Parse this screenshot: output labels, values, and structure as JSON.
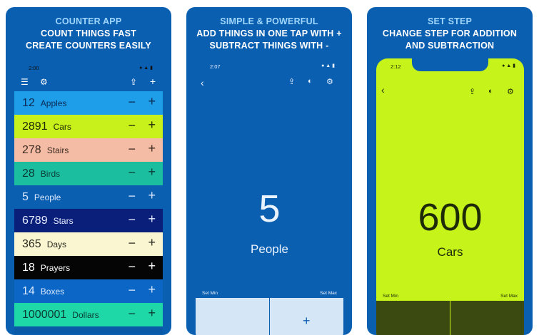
{
  "panel1": {
    "caption": [
      "COUNTER APP",
      "COUNT THINGS FAST",
      "CREATE COUNTERS EASILY"
    ],
    "time": "2:00",
    "status_icons": "● ▲ ▮",
    "menu_icon": "☰",
    "settings_icon": "⚙",
    "share_icon": "⇪",
    "add_icon": "+",
    "counters": [
      {
        "count": "12",
        "name": "Apples",
        "bg": "#1e9de8",
        "fg": "#0b2b55"
      },
      {
        "count": "2891",
        "name": "Cars",
        "bg": "#c8f01a",
        "fg": "#1d2a0a"
      },
      {
        "count": "278",
        "name": "Stairs",
        "bg": "#f4bca5",
        "fg": "#3a2a20"
      },
      {
        "count": "28",
        "name": "Birds",
        "bg": "#1bbfa0",
        "fg": "#0c3b36"
      },
      {
        "count": "5",
        "name": "People",
        "bg": "#0b5fb0",
        "fg": "#d9e8ff"
      },
      {
        "count": "6789",
        "name": "Stars",
        "bg": "#0a1f7a",
        "fg": "#e8ecff"
      },
      {
        "count": "365",
        "name": "Days",
        "bg": "#faf6d2",
        "fg": "#2c2c20"
      },
      {
        "count": "18",
        "name": "Prayers",
        "bg": "#050505",
        "fg": "#ffffff"
      },
      {
        "count": "14",
        "name": "Boxes",
        "bg": "#0b66c6",
        "fg": "#d9e8ff"
      },
      {
        "count": "1000001",
        "name": "Dollars",
        "bg": "#1fd8a8",
        "fg": "#0b3b30"
      }
    ],
    "minus": "−",
    "plus": "+"
  },
  "panel2": {
    "caption": [
      "SIMPLE & POWERFUL",
      "ADD THINGS IN ONE TAP WITH +",
      "SUBTRACT THINGS WITH -"
    ],
    "time": "2:07",
    "status_icons": "● ▲ ▮",
    "back_icon": "‹",
    "share_icon": "⇪",
    "palette_icon": "◐",
    "settings_icon": "⚙",
    "count": "5",
    "name": "People",
    "set_min": "Set Min",
    "set_max": "Set Max",
    "bg": "#0b5fb0",
    "text": "#e9f2ff",
    "plus": "+"
  },
  "panel3": {
    "caption": [
      "SET STEP",
      "CHANGE STEP FOR ADDITION",
      "AND SUBTRACTION"
    ],
    "time": "2:12",
    "status_icons": "● ▲ ▮",
    "back_icon": "‹",
    "share_icon": "⇪",
    "palette_icon": "◐",
    "settings_icon": "⚙",
    "count": "600",
    "name": "Cars",
    "set_min": "Set Min",
    "set_max": "Set Max",
    "bg": "#c6f31a",
    "text": "#1e2a08"
  }
}
